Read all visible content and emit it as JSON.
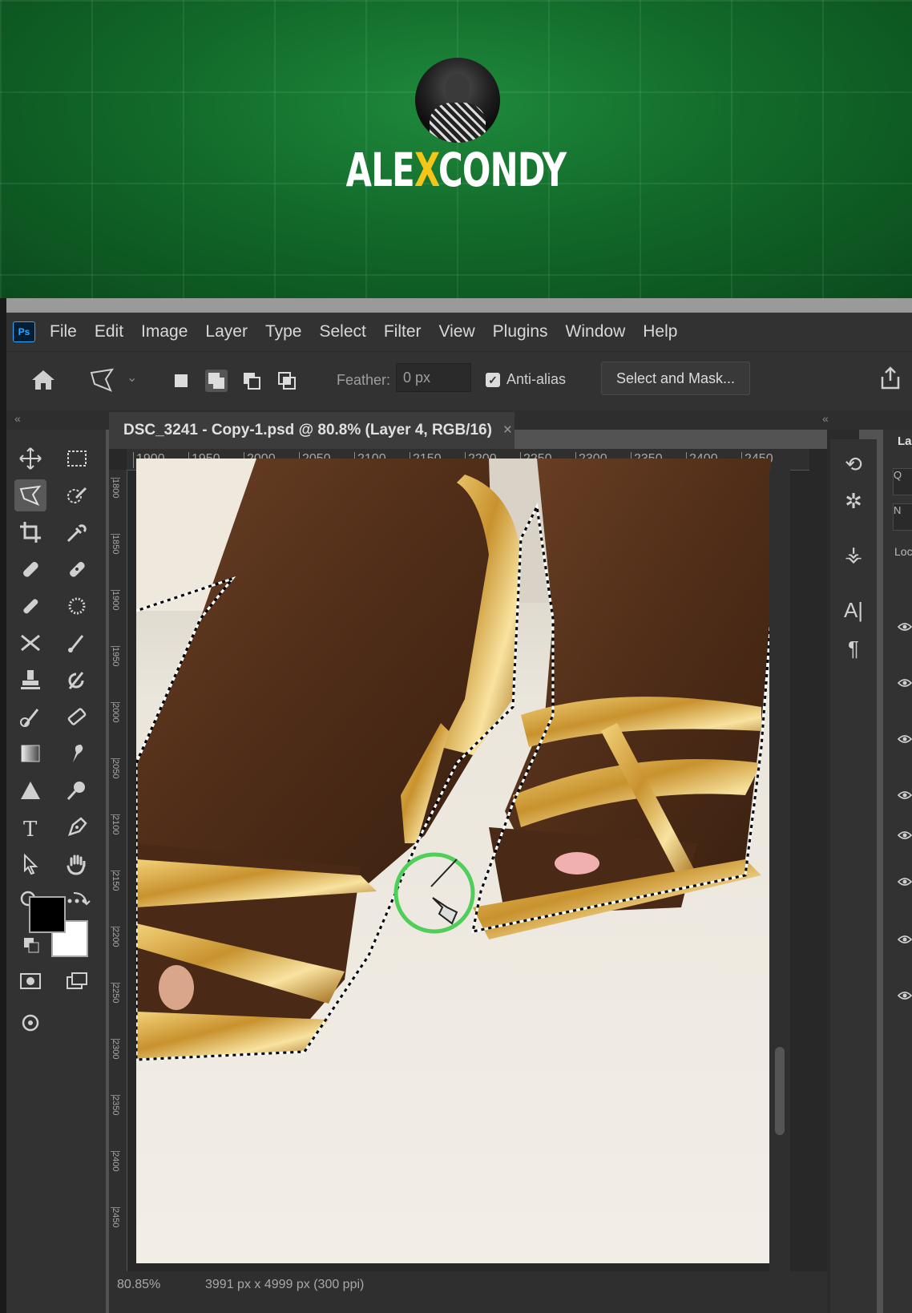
{
  "banner": {
    "brand_left": "ALE",
    "brand_x": "X",
    "brand_right": "CONDY"
  },
  "menu": {
    "logo": "Ps",
    "items": [
      "File",
      "Edit",
      "Image",
      "Layer",
      "Type",
      "Select",
      "Filter",
      "View",
      "Plugins",
      "Window",
      "Help"
    ]
  },
  "options": {
    "feather_label": "Feather:",
    "feather_value": "0 px",
    "antialias_label": "Anti-alias",
    "antialias_checked": true,
    "select_mask_label": "Select and Mask..."
  },
  "document": {
    "tab_title": "DSC_3241 - Copy-1.psd @ 80.8% (Layer 4, RGB/16)",
    "close_glyph": "×",
    "ruler_top": [
      "1900",
      "1950",
      "2000",
      "2050",
      "2100",
      "2150",
      "2200",
      "2250",
      "2300",
      "2350",
      "2400",
      "2450"
    ],
    "ruler_left": [
      "1800",
      "1850",
      "1900",
      "1950",
      "2000",
      "2050",
      "2100",
      "2150",
      "2200",
      "2250",
      "2300",
      "2350",
      "2400",
      "2450"
    ],
    "status_zoom": "80.85%",
    "status_size": "3991 px x 4999 px (300 ppi)"
  },
  "right_panel": {
    "layers_header": "La",
    "search_glyph": "Q",
    "mode_glyph": "N",
    "lock_label": "Loc"
  },
  "colors": {
    "ps_ui": "#323232",
    "accent_blue": "#31a8ff",
    "brand_yellow": "#f5c518",
    "banner_green": "#126a2a"
  }
}
